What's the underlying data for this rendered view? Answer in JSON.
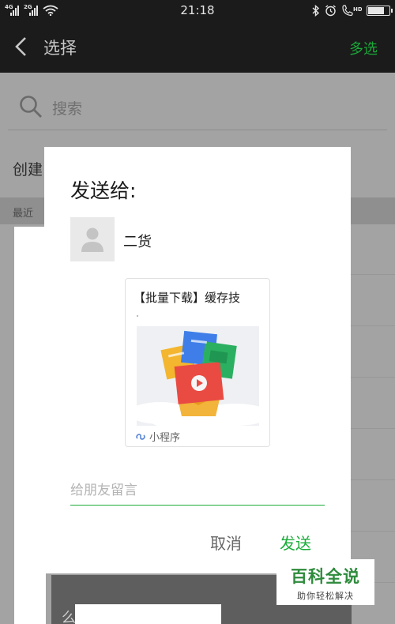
{
  "status_bar": {
    "time": "21:18",
    "signal_1": "4G",
    "signal_2": "2G",
    "volte": "HD",
    "battery_level": 0.85
  },
  "nav": {
    "title": "选择",
    "multi_select": "多选"
  },
  "background_list": {
    "search_placeholder": "搜索",
    "create_label": "创建",
    "recent_label": "最近",
    "partial_char": "么"
  },
  "dialog": {
    "title": "发送给:",
    "recipient_name": "二货",
    "card_title": "【批量下载】缓存技",
    "card_source": "小程序",
    "message_placeholder": "给朋友留言",
    "cancel_label": "取消",
    "send_label": "发送"
  },
  "watermark": {
    "main": "百科全说",
    "sub": "助你轻松解决"
  },
  "colors": {
    "accent_green": "#1aad3a",
    "bar_dark": "#1b1b1b",
    "dim_overlay": "#a3a3a3"
  }
}
